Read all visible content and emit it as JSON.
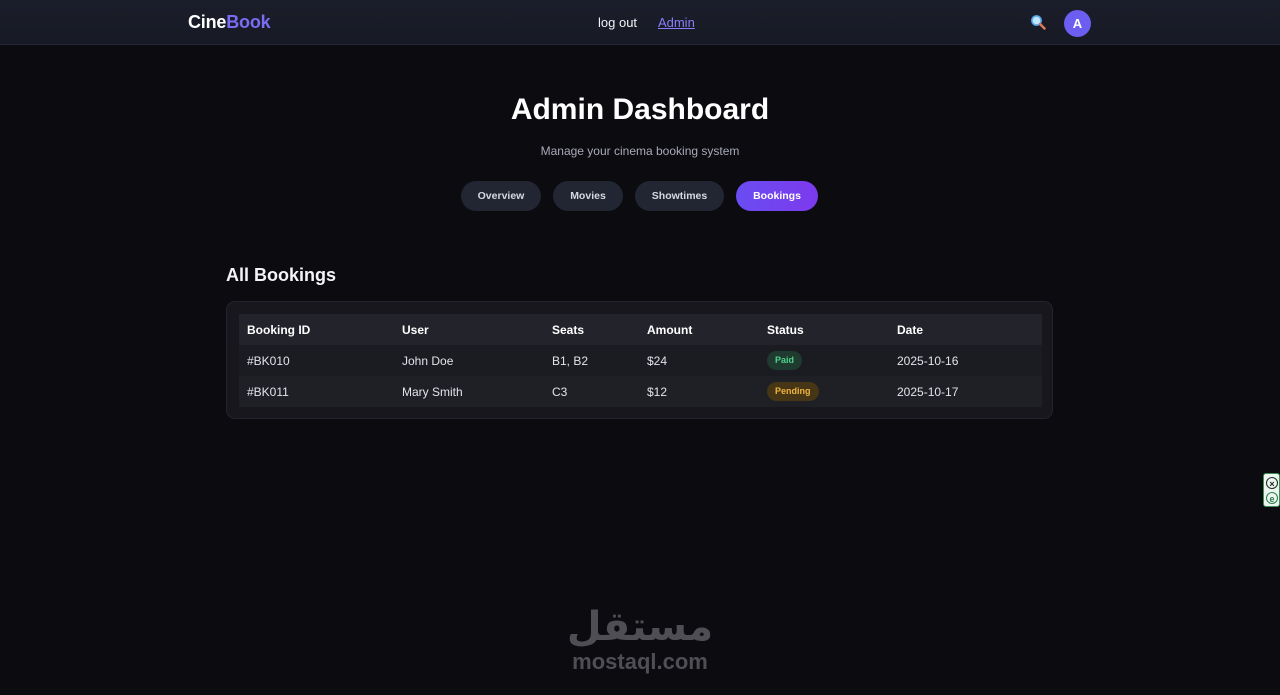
{
  "brand": {
    "part1": "Cine",
    "part2": "Book"
  },
  "nav": {
    "logout": "log out",
    "admin": "Admin"
  },
  "icons": {
    "search": "search-icon"
  },
  "avatar": {
    "initial": "A"
  },
  "header": {
    "title": "Admin Dashboard",
    "subtitle": "Manage your cinema booking system"
  },
  "tabs": [
    {
      "label": "Overview",
      "active": false
    },
    {
      "label": "Movies",
      "active": false
    },
    {
      "label": "Showtimes",
      "active": false
    },
    {
      "label": "Bookings",
      "active": true
    }
  ],
  "section": {
    "title": "All Bookings"
  },
  "table": {
    "columns": [
      "Booking ID",
      "User",
      "Seats",
      "Amount",
      "Status",
      "Date"
    ],
    "rows": [
      {
        "id": "#BK010",
        "user": "John Doe",
        "seats": "B1, B2",
        "amount": "$24",
        "status": "Paid",
        "date": "2025-10-16"
      },
      {
        "id": "#BK011",
        "user": "Mary Smith",
        "seats": "C3",
        "amount": "$12",
        "status": "Pending",
        "date": "2025-10-17"
      }
    ]
  },
  "watermark": {
    "arabic": "مستقل",
    "latin": "mostaql.com"
  },
  "colors": {
    "accent": "#7b6cf6",
    "background": "#0b0b10",
    "paid": "#4fd18b",
    "pending": "#f0b43f"
  }
}
